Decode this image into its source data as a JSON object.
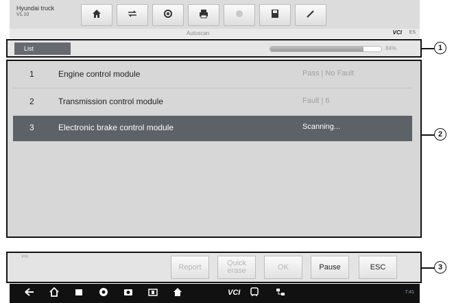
{
  "app": {
    "title": "Hyundai truck",
    "version": "V1.10"
  },
  "toolbar": {
    "icons": [
      "home-icon",
      "vehicle-swap-icon",
      "settings-icon",
      "print-icon",
      "help-icon",
      "save-icon",
      "edit-icon"
    ]
  },
  "status_line": {
    "screen_label": "Autoscan",
    "vci": "VCI",
    "vci_extra": "ES"
  },
  "region1": {
    "tab_label": "List",
    "progress_percent": 84,
    "progress_text": "84%"
  },
  "modules": [
    {
      "num": "1",
      "name": "Engine control module",
      "status": "Pass | No Fault",
      "selected": false
    },
    {
      "num": "2",
      "name": "Transmission control module",
      "status": "Fault | 6",
      "selected": false
    },
    {
      "num": "3",
      "name": "Electronic brake control module",
      "status": "Scanning...",
      "selected": true
    }
  ],
  "footer": {
    "tiny_label": "VIN",
    "buttons": [
      {
        "label": "Report",
        "enabled": false
      },
      {
        "label": "Quick erase",
        "enabled": false
      },
      {
        "label": "OK",
        "enabled": false
      },
      {
        "label": "Pause",
        "enabled": true
      },
      {
        "label": "ESC",
        "enabled": true
      }
    ]
  },
  "navbar": {
    "vci_label": "VCI",
    "status_text": "7:41"
  },
  "callouts": [
    "1",
    "2",
    "3"
  ],
  "colors": {
    "selected_row": "#5d6168",
    "tab": "#666a70",
    "nav": "#111111"
  }
}
